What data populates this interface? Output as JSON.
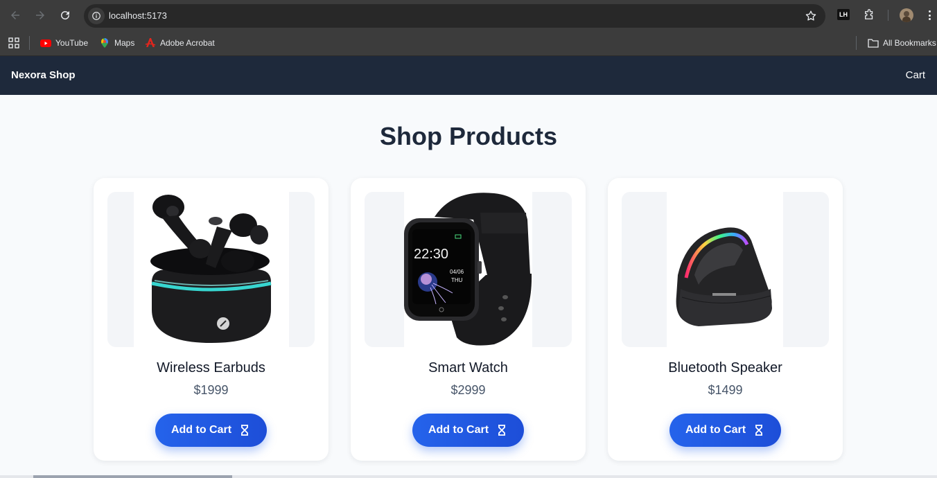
{
  "browser": {
    "url": "localhost:5173",
    "bookmarks": [
      {
        "label": "YouTube",
        "icon": "youtube-icon"
      },
      {
        "label": "Maps",
        "icon": "maps-icon"
      },
      {
        "label": "Adobe Acrobat",
        "icon": "acrobat-icon"
      }
    ],
    "all_bookmarks": "All Bookmarks",
    "extension_badge": "LH"
  },
  "app": {
    "brand": "Nexora Shop",
    "cart_link": "Cart",
    "title": "Shop Products",
    "accent": "#2563eb",
    "nav_bg": "#1e293b"
  },
  "products": [
    {
      "name": "Wireless Earbuds",
      "price": "$1999",
      "button": "Add to Cart",
      "image": "earbuds-image"
    },
    {
      "name": "Smart Watch",
      "price": "$2999",
      "button": "Add to Cart",
      "image": "smartwatch-image",
      "screen_time": "22:30",
      "screen_date": "04/06",
      "screen_day": "THU"
    },
    {
      "name": "Bluetooth Speaker",
      "price": "$1499",
      "button": "Add to Cart",
      "image": "speaker-image"
    }
  ]
}
